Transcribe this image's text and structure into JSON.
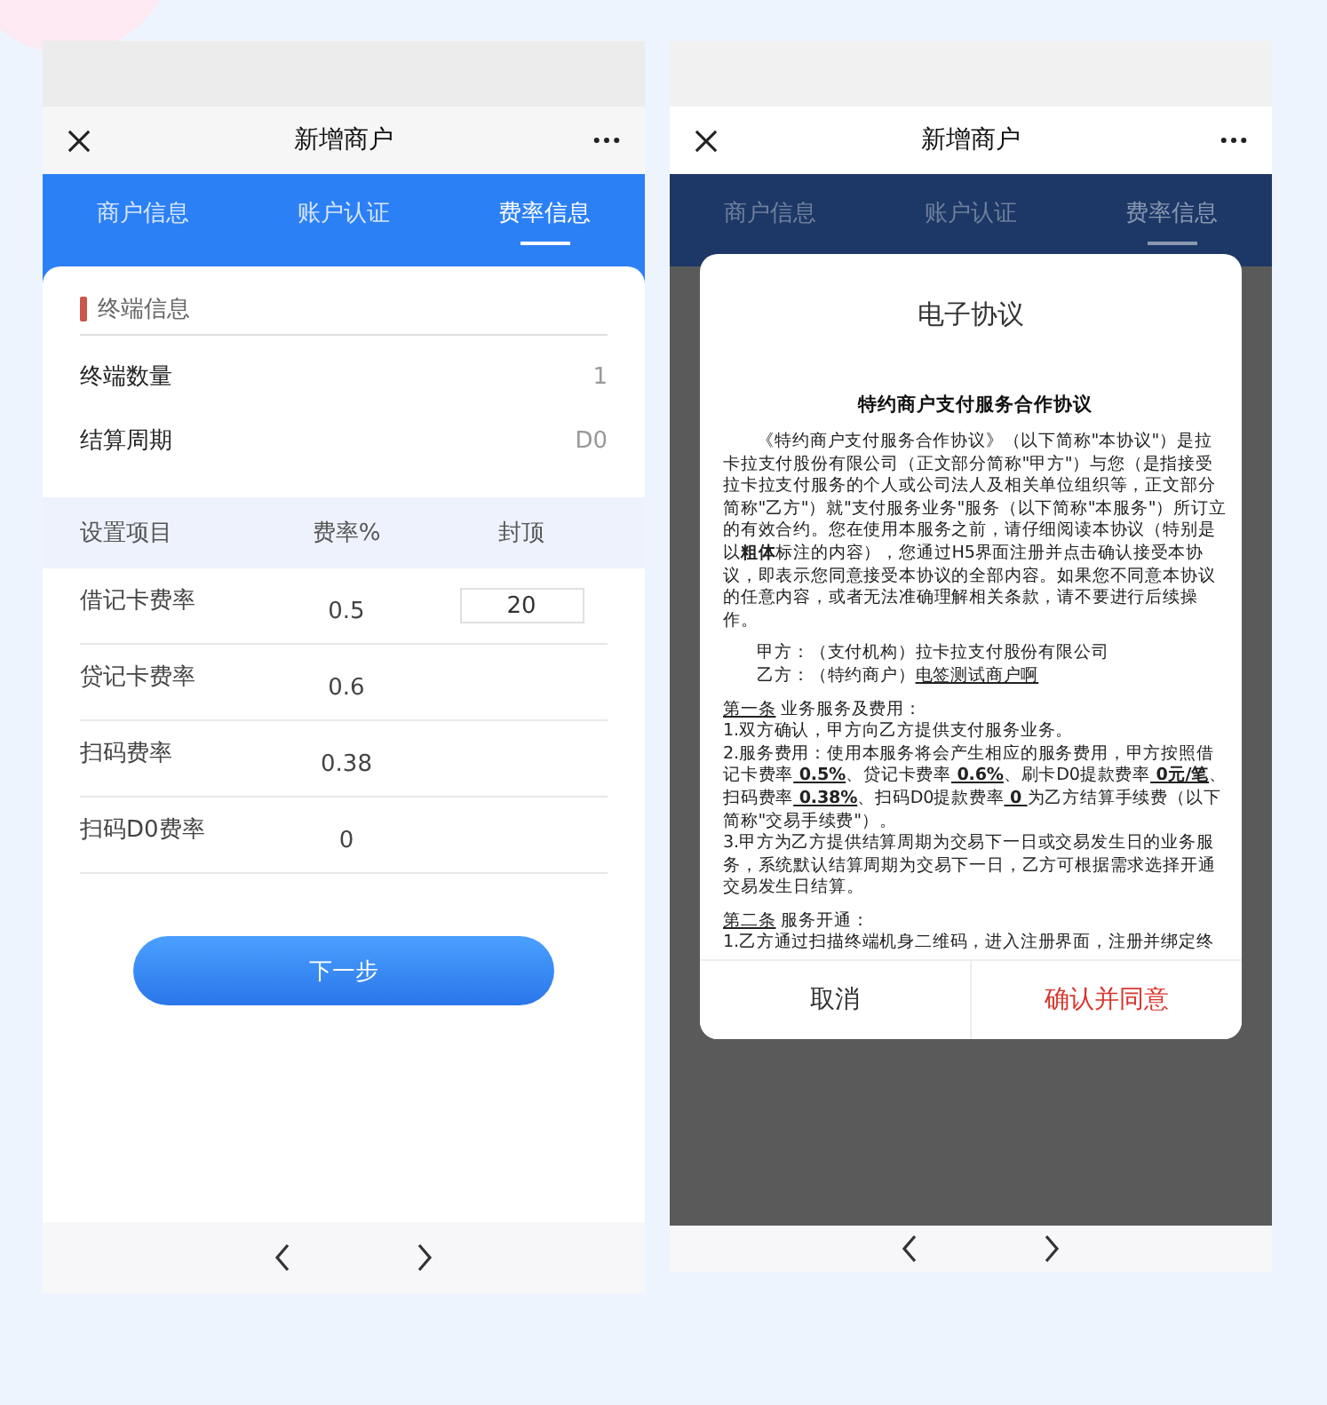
{
  "left_phone": {
    "title": "新增商户",
    "tabs": [
      {
        "label": "商户信息",
        "selected": false
      },
      {
        "label": "账户认证",
        "selected": false
      },
      {
        "label": "费率信息",
        "selected": true
      }
    ],
    "section_title": "终端信息",
    "info_rows": [
      {
        "label": "终端数量",
        "value": "1"
      },
      {
        "label": "结算周期",
        "value": "D0"
      }
    ],
    "table": {
      "columns": [
        "设置项目",
        "费率%",
        "封顶"
      ],
      "rows": [
        {
          "item": "借记卡费率",
          "rate": "0.5",
          "cap": "20"
        },
        {
          "item": "贷记卡费率",
          "rate": "0.6"
        },
        {
          "item": "扫码费率",
          "rate": "0.38"
        },
        {
          "item": "扫码D0费率",
          "rate": "0"
        }
      ]
    },
    "next_button": "下一步"
  },
  "right_phone": {
    "title": "新增商户",
    "tabs": [
      {
        "label": "商户信息",
        "selected": false
      },
      {
        "label": "账户认证",
        "selected": false
      },
      {
        "label": "费率信息",
        "selected": true
      }
    ],
    "dialog": {
      "title": "电子协议",
      "heading": "特约商户支付服务合作协议",
      "paragraphs": [
        {
          "kind": "indent",
          "segments": [
            {
              "kind": "plain",
              "text": "《特约商户支付服务合作协议》（以下简称\"本协议\"）是拉卡拉支付股份有限公司（正文部分简称\"甲方\"）与您（是指接受拉卡拉支付服务的个人或公司法人及相关单位组织等，正文部分简称\"乙方\"）就\"支付服务业务\"服务（以下简称\"本服务\"）所订立的有效合约。您在使用本服务之前，请仔细阅读本协议（特别是以"
            },
            {
              "kind": "bold",
              "text": "粗体"
            },
            {
              "kind": "plain",
              "text": "标注的内容），您通过H5界面注册并点击确认接受本协议，即表示您同意接受本协议的全部内容。如果您不同意本协议的任意内容，或者无法准确理解相关条款，请不要进行后续操作。"
            }
          ]
        },
        {
          "kind": "party",
          "segments": [
            {
              "kind": "plain",
              "text": "甲方：（支付机构）拉卡拉支付股份有限公司"
            }
          ]
        },
        {
          "kind": "party_next",
          "segments": [
            {
              "kind": "plain",
              "text": "乙方：（特约商户）"
            },
            {
              "kind": "underline",
              "text": "电签测试商户啊"
            }
          ]
        },
        {
          "kind": "clause",
          "segments": [
            {
              "kind": "underline",
              "text": "第一条"
            },
            {
              "kind": "plain",
              "text": " 业务服务及费用："
            }
          ]
        },
        {
          "kind": "body",
          "segments": [
            {
              "kind": "plain",
              "text": "1.双方确认，甲方向乙方提供支付服务业务。"
            }
          ]
        },
        {
          "kind": "body",
          "segments": [
            {
              "kind": "plain",
              "text": "2.服务费用：使用本服务将会产生相应的服务费用，甲方按照借记卡费率"
            },
            {
              "kind": "bold_underline",
              "text": " 0.5%"
            },
            {
              "kind": "plain",
              "text": "、贷记卡费率"
            },
            {
              "kind": "bold_underline",
              "text": " 0.6%"
            },
            {
              "kind": "plain",
              "text": "、刷卡D0提款费率"
            },
            {
              "kind": "bold_underline",
              "text": " 0元/笔"
            },
            {
              "kind": "plain",
              "text": "、扫码费率"
            },
            {
              "kind": "bold_underline",
              "text": " 0.38%"
            },
            {
              "kind": "plain",
              "text": "、扫码D0提款费率"
            },
            {
              "kind": "bold_underline",
              "text": " 0 "
            },
            {
              "kind": "plain",
              "text": "为乙方结算手续费（以下简称\"交易手续费\"）。"
            }
          ]
        },
        {
          "kind": "body",
          "segments": [
            {
              "kind": "plain",
              "text": "3.甲方为乙方提供结算周期为交易下一日或交易发生日的业务服务，系统默认结算周期为交易下一日，乙方可根据需求选择开通交易发生日结算。"
            }
          ]
        },
        {
          "kind": "clause",
          "segments": [
            {
              "kind": "underline",
              "text": "第二条"
            },
            {
              "kind": "plain",
              "text": " 服务开通："
            }
          ]
        },
        {
          "kind": "body",
          "segments": [
            {
              "kind": "plain",
              "text": "1.乙方通过扫描终端机身二维码，进入注册界面，注册并绑定终"
            }
          ]
        }
      ],
      "cancel": "取消",
      "confirm": "确认并同意"
    }
  }
}
